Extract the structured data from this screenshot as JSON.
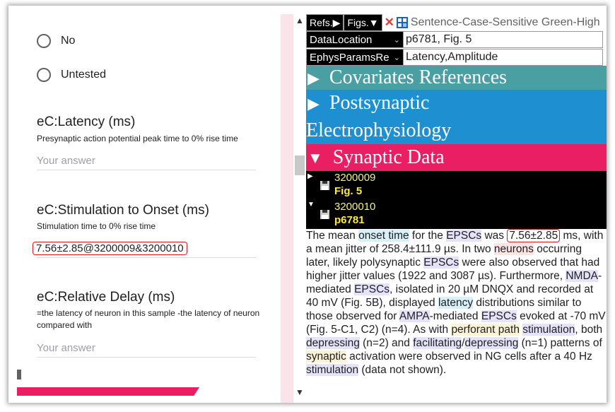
{
  "form": {
    "options": [
      "No",
      "Untested"
    ],
    "questions": [
      {
        "title": "eC:Latency (ms)",
        "help": "Presynaptic action potential peak time to 0% rise time",
        "answer": "",
        "placeholder": "Your answer"
      },
      {
        "title": "eC:Stimulation to Onset (ms)",
        "help": "Stimulation time to 0% rise time",
        "answer": "7.56±2.85@3200009&3200010",
        "placeholder": ""
      },
      {
        "title": "eC:Relative Delay (ms)",
        "help": "=the latency of neuron in this sample -the latency of neuron compared with",
        "answer": "",
        "placeholder": "Your answer"
      }
    ]
  },
  "panel": {
    "toolbar": {
      "refs": "Refs.▶",
      "figs": "Figs.▼",
      "close_glyph": "✕",
      "search_text": "Sentence-Case-Sensitive Green-High"
    },
    "rows": [
      {
        "select": "DataLocation",
        "value": "p6781, Fig. 5"
      },
      {
        "select": "EphysParamsRe",
        "value": "Latency,Amplitude"
      }
    ],
    "sections": [
      "Covariates References",
      "Postsynaptic",
      "Electrophysiology",
      "Synaptic Data"
    ],
    "tree": [
      {
        "id": "3200009",
        "sub": "Fig. 5"
      },
      {
        "id": "3200010",
        "sub": "p6781"
      }
    ],
    "text": [
      {
        "t": "The mean "
      },
      {
        "t": "onset time",
        "c": "c"
      },
      {
        "t": " for the "
      },
      {
        "t": "EPSCs",
        "c": "p"
      },
      {
        "t": " was "
      },
      {
        "t": "7.56±2.85",
        "c": "box"
      },
      {
        "t": " ms, with a mean jitter of 258.4±111.9 µs. In two "
      },
      {
        "t": "neurons",
        "c": "r"
      },
      {
        "t": " occurring later, likely polysynaptic "
      },
      {
        "t": "EPSCs",
        "c": "p"
      },
      {
        "t": " were also observed that had higher jitter values (1922 and 3087 µs). Furthermore, "
      },
      {
        "t": "NMDA",
        "c": "p"
      },
      {
        "t": "-mediated "
      },
      {
        "t": "EPSCs",
        "c": "p"
      },
      {
        "t": ", isolated in 20 µM DNQX and recorded at 40 mV (Fig. 5B), displayed "
      },
      {
        "t": "latency",
        "c": "c"
      },
      {
        "t": " distributions similar to those observed for "
      },
      {
        "t": "AMPA",
        "c": "p"
      },
      {
        "t": "-mediated "
      },
      {
        "t": "EPSCs",
        "c": "p"
      },
      {
        "t": " evoked at -70 mV (Fig. 5-C1, C2) (n=4). As with "
      },
      {
        "t": "perforant path",
        "c": "y"
      },
      {
        "t": " "
      },
      {
        "t": "stimulation",
        "c": "p"
      },
      {
        "t": ", both "
      },
      {
        "t": "depressing",
        "c": "p"
      },
      {
        "t": " (n=2) and "
      },
      {
        "t": "facilitating",
        "c": "p"
      },
      {
        "t": "/"
      },
      {
        "t": "depressing",
        "c": "p"
      },
      {
        "t": " (n=1) patterns of "
      },
      {
        "t": "synaptic",
        "c": "y"
      },
      {
        "t": " activation were observed in NG cells after a 40 Hz "
      },
      {
        "t": "stimulation",
        "c": "p"
      },
      {
        "t": " (data not shown)."
      }
    ]
  },
  "colors": {
    "teal": "#4a9fa3",
    "blue": "#1e90d2",
    "pink": "#e91e63",
    "highlight_red": "#d81b1b"
  }
}
